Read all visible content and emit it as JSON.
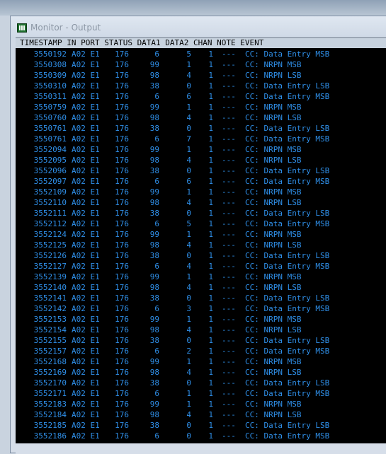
{
  "window": {
    "title": "Monitor - Output"
  },
  "header": "TIMESTAMP IN PORT STATUS DATA1 DATA2 CHAN NOTE EVENT",
  "rows": [
    [
      "3550192",
      "A02 E1",
      "176",
      "6",
      "5",
      "1",
      "---",
      "CC: Data Entry MSB"
    ],
    [
      "3550308",
      "A02 E1",
      "176",
      "99",
      "1",
      "1",
      "---",
      "CC: NRPN MSB"
    ],
    [
      "3550309",
      "A02 E1",
      "176",
      "98",
      "4",
      "1",
      "---",
      "CC: NRPN LSB"
    ],
    [
      "3550310",
      "A02 E1",
      "176",
      "38",
      "0",
      "1",
      "---",
      "CC: Data Entry LSB"
    ],
    [
      "3550311",
      "A02 E1",
      "176",
      "6",
      "6",
      "1",
      "---",
      "CC: Data Entry MSB"
    ],
    [
      "3550759",
      "A02 E1",
      "176",
      "99",
      "1",
      "1",
      "---",
      "CC: NRPN MSB"
    ],
    [
      "3550760",
      "A02 E1",
      "176",
      "98",
      "4",
      "1",
      "---",
      "CC: NRPN LSB"
    ],
    [
      "3550761",
      "A02 E1",
      "176",
      "38",
      "0",
      "1",
      "---",
      "CC: Data Entry LSB"
    ],
    [
      "3550761",
      "A02 E1",
      "176",
      "6",
      "7",
      "1",
      "---",
      "CC: Data Entry MSB"
    ],
    [
      "3552094",
      "A02 E1",
      "176",
      "99",
      "1",
      "1",
      "---",
      "CC: NRPN MSB"
    ],
    [
      "3552095",
      "A02 E1",
      "176",
      "98",
      "4",
      "1",
      "---",
      "CC: NRPN LSB"
    ],
    [
      "3552096",
      "A02 E1",
      "176",
      "38",
      "0",
      "1",
      "---",
      "CC: Data Entry LSB"
    ],
    [
      "3552097",
      "A02 E1",
      "176",
      "6",
      "6",
      "1",
      "---",
      "CC: Data Entry MSB"
    ],
    [
      "3552109",
      "A02 E1",
      "176",
      "99",
      "1",
      "1",
      "---",
      "CC: NRPN MSB"
    ],
    [
      "3552110",
      "A02 E1",
      "176",
      "98",
      "4",
      "1",
      "---",
      "CC: NRPN LSB"
    ],
    [
      "3552111",
      "A02 E1",
      "176",
      "38",
      "0",
      "1",
      "---",
      "CC: Data Entry LSB"
    ],
    [
      "3552112",
      "A02 E1",
      "176",
      "6",
      "5",
      "1",
      "---",
      "CC: Data Entry MSB"
    ],
    [
      "3552124",
      "A02 E1",
      "176",
      "99",
      "1",
      "1",
      "---",
      "CC: NRPN MSB"
    ],
    [
      "3552125",
      "A02 E1",
      "176",
      "98",
      "4",
      "1",
      "---",
      "CC: NRPN LSB"
    ],
    [
      "3552126",
      "A02 E1",
      "176",
      "38",
      "0",
      "1",
      "---",
      "CC: Data Entry LSB"
    ],
    [
      "3552127",
      "A02 E1",
      "176",
      "6",
      "4",
      "1",
      "---",
      "CC: Data Entry MSB"
    ],
    [
      "3552139",
      "A02 E1",
      "176",
      "99",
      "1",
      "1",
      "---",
      "CC: NRPN MSB"
    ],
    [
      "3552140",
      "A02 E1",
      "176",
      "98",
      "4",
      "1",
      "---",
      "CC: NRPN LSB"
    ],
    [
      "3552141",
      "A02 E1",
      "176",
      "38",
      "0",
      "1",
      "---",
      "CC: Data Entry LSB"
    ],
    [
      "3552142",
      "A02 E1",
      "176",
      "6",
      "3",
      "1",
      "---",
      "CC: Data Entry MSB"
    ],
    [
      "3552153",
      "A02 E1",
      "176",
      "99",
      "1",
      "1",
      "---",
      "CC: NRPN MSB"
    ],
    [
      "3552154",
      "A02 E1",
      "176",
      "98",
      "4",
      "1",
      "---",
      "CC: NRPN LSB"
    ],
    [
      "3552155",
      "A02 E1",
      "176",
      "38",
      "0",
      "1",
      "---",
      "CC: Data Entry LSB"
    ],
    [
      "3552157",
      "A02 E1",
      "176",
      "6",
      "2",
      "1",
      "---",
      "CC: Data Entry MSB"
    ],
    [
      "3552168",
      "A02 E1",
      "176",
      "99",
      "1",
      "1",
      "---",
      "CC: NRPN MSB"
    ],
    [
      "3552169",
      "A02 E1",
      "176",
      "98",
      "4",
      "1",
      "---",
      "CC: NRPN LSB"
    ],
    [
      "3552170",
      "A02 E1",
      "176",
      "38",
      "0",
      "1",
      "---",
      "CC: Data Entry LSB"
    ],
    [
      "3552171",
      "A02 E1",
      "176",
      "6",
      "1",
      "1",
      "---",
      "CC: Data Entry MSB"
    ],
    [
      "3552183",
      "A02 E1",
      "176",
      "99",
      "1",
      "1",
      "---",
      "CC: NRPN MSB"
    ],
    [
      "3552184",
      "A02 E1",
      "176",
      "98",
      "4",
      "1",
      "---",
      "CC: NRPN LSB"
    ],
    [
      "3552185",
      "A02 E1",
      "176",
      "38",
      "0",
      "1",
      "---",
      "CC: Data Entry LSB"
    ],
    [
      "3552186",
      "A02 E1",
      "176",
      "6",
      "0",
      "1",
      "---",
      "CC: Data Entry MSB"
    ]
  ],
  "colors": {
    "console_bg": "#000000",
    "row_text": "#2f8fe8",
    "header_bg": "#c7d2de"
  },
  "icons": {
    "app": "monitor-app-icon"
  }
}
